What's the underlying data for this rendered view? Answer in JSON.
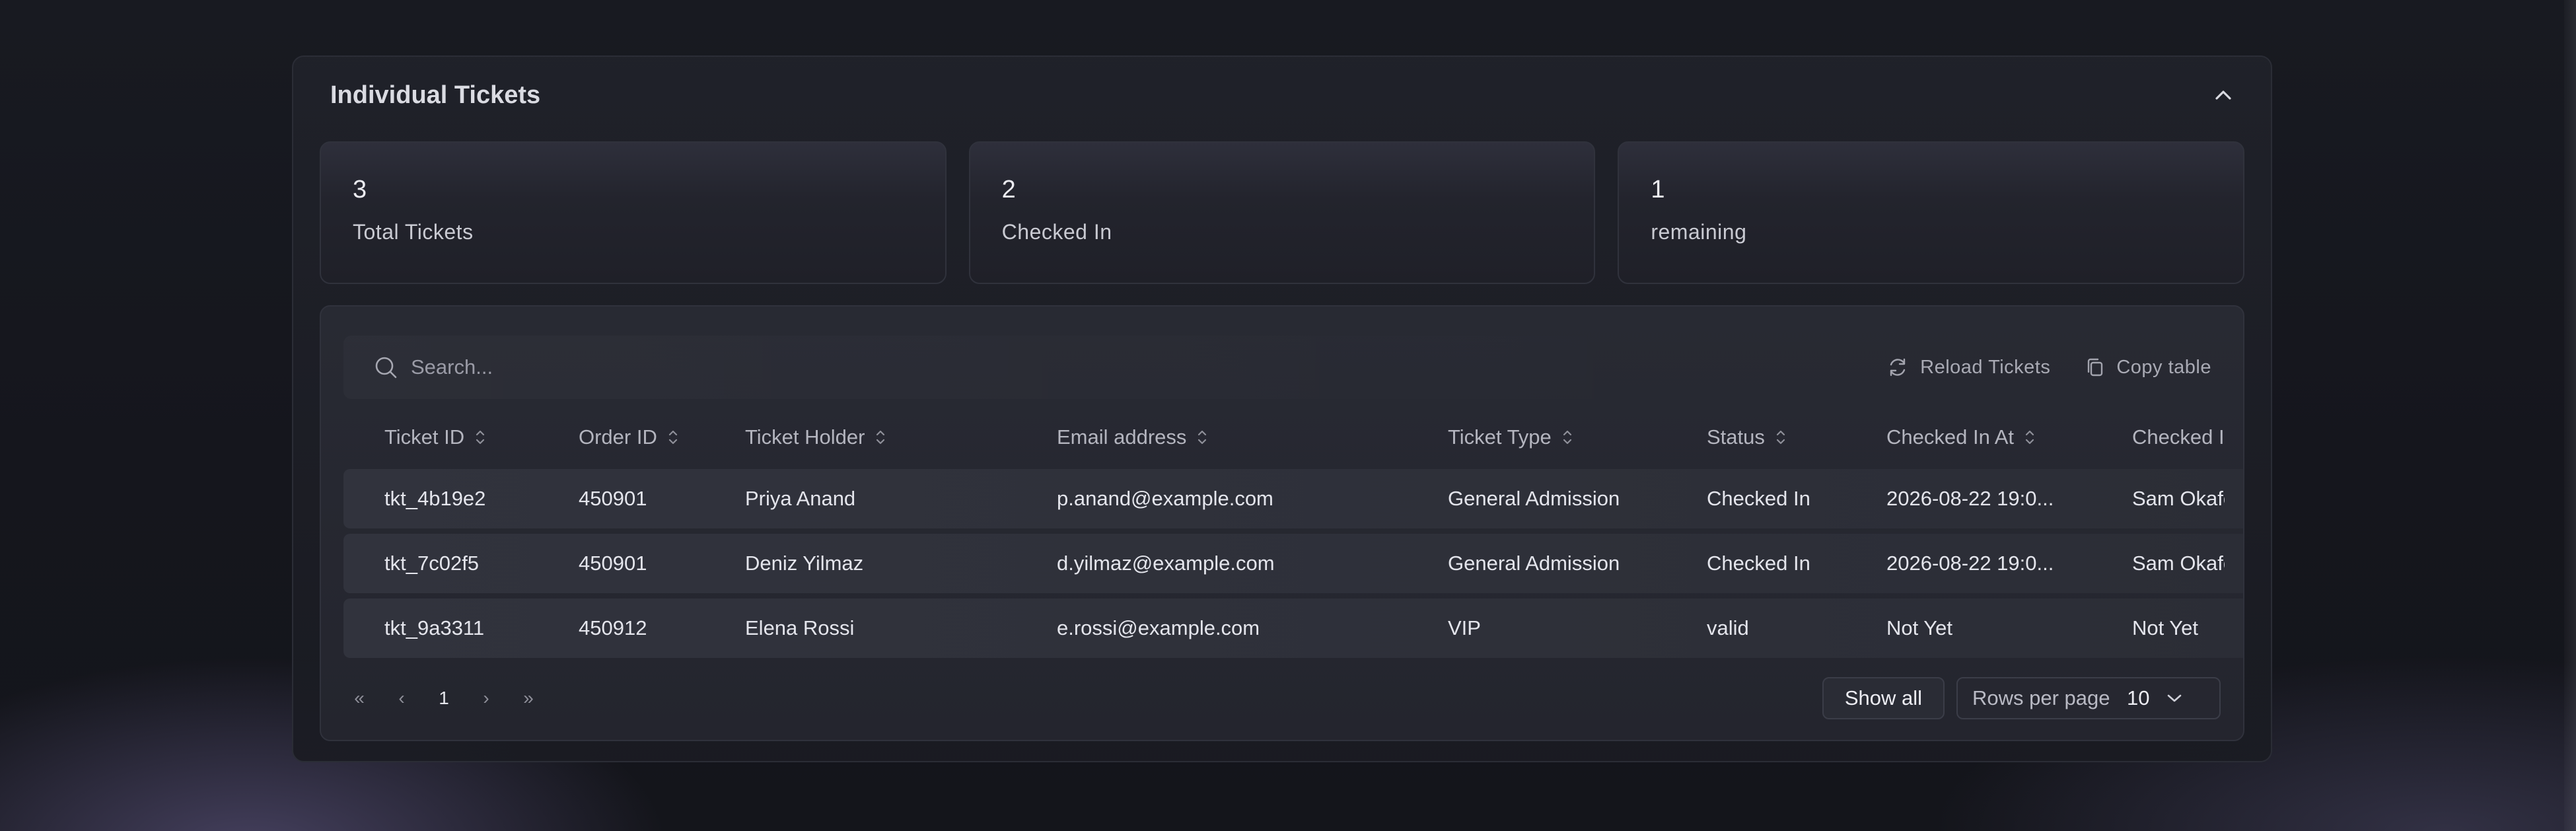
{
  "panel": {
    "title": "Individual Tickets"
  },
  "stats": [
    {
      "value": "3",
      "label": "Total Tickets"
    },
    {
      "value": "2",
      "label": "Checked In"
    },
    {
      "value": "1",
      "label": "remaining"
    }
  ],
  "toolbar": {
    "search_placeholder": "Search...",
    "reload_label": "Reload Tickets",
    "copy_label": "Copy table"
  },
  "table": {
    "columns": [
      "Ticket ID",
      "Order ID",
      "Ticket Holder",
      "Email address",
      "Ticket Type",
      "Status",
      "Checked In At",
      "Checked I"
    ],
    "rows": [
      [
        "tkt_4b19e2",
        "450901",
        "Priya Anand",
        "p.anand@example.com",
        "General Admission",
        "Checked In",
        "2026-08-22 19:0...",
        "Sam Okafo"
      ],
      [
        "tkt_7c02f5",
        "450901",
        "Deniz Yilmaz",
        "d.yilmaz@example.com",
        "General Admission",
        "Checked In",
        "2026-08-22 19:0...",
        "Sam Okafo"
      ],
      [
        "tkt_9a3311",
        "450912",
        "Elena Rossi",
        "e.rossi@example.com",
        "VIP",
        "valid",
        "Not Yet",
        "Not Yet"
      ]
    ]
  },
  "pagination": {
    "first": "«",
    "prev": "‹",
    "current": "1",
    "next": "›",
    "last": "»"
  },
  "footer": {
    "show_all_label": "Show all",
    "rows_per_page_label": "Rows per page",
    "rows_per_page_value": "10"
  }
}
